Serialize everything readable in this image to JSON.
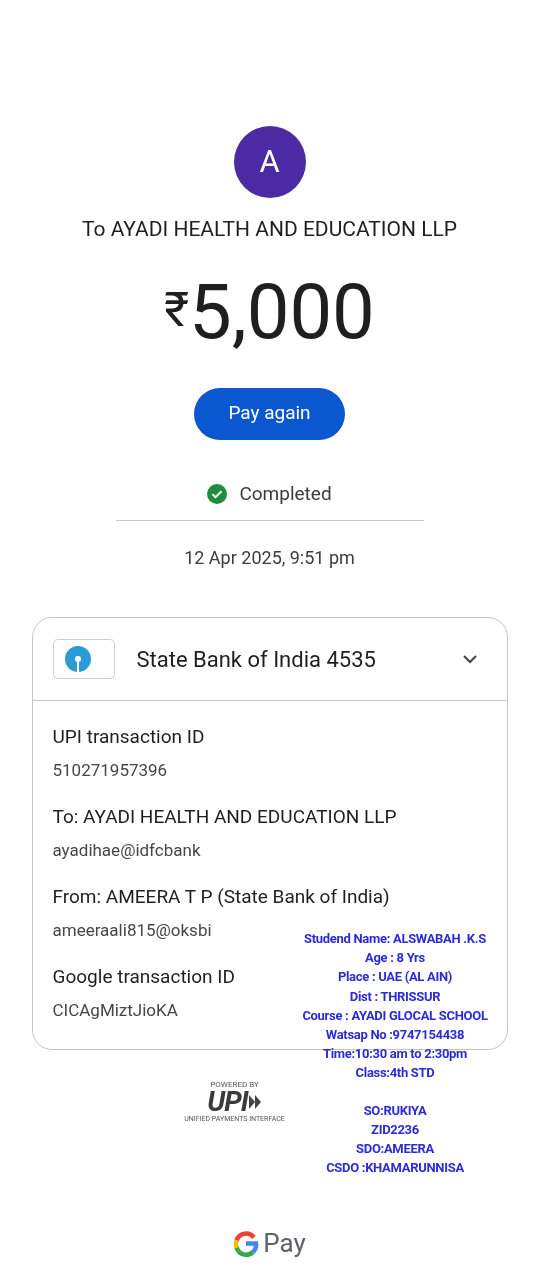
{
  "payee": {
    "avatar_letter": "A",
    "title": "To AYADI HEALTH AND EDUCATION LLP"
  },
  "amount": {
    "currency": "₹",
    "value": "5,000"
  },
  "pay_again_button": "Pay again",
  "status": {
    "label": "Completed",
    "kind": "completed"
  },
  "datetime": "12 Apr 2025, 9:51 pm",
  "details_card": {
    "bank": "State Bank of India 4535",
    "expanded": true,
    "rows": [
      {
        "label": "UPI transaction ID",
        "value": "510271957396"
      },
      {
        "label": "To: AYADI HEALTH AND EDUCATION LLP",
        "value": "ayadihae@idfcbank"
      },
      {
        "label": "From: AMEERA  T P (State Bank of India)",
        "value": "ameeraali815@oksbi"
      },
      {
        "label": "Google transaction ID",
        "value": "CICAgMiztJioKA"
      }
    ]
  },
  "upi_logo": {
    "caption": "POWERED BY",
    "mark": "UPI",
    "subtitle": "UNIFIED PAYMENTS INTERFACE"
  },
  "overlay_note": {
    "lines": [
      "Studend Name: ALSWABAH .K.S",
      "Age : 8 Yrs",
      "Place  : UAE (AL AIN)",
      "Dist : THRISSUR",
      "Course : AYADI GLOCAL SCHOOL",
      "Watsap No :9747154438",
      "Time:10:30 am to 2:30pm",
      "Class:4th STD"
    ],
    "lines_2": [
      "SO:RUKIYA",
      "ZID2236",
      "SDO:AMEERA",
      "CSDO :KHAMARUNNISA"
    ]
  },
  "footer": {
    "brand": "Pay"
  }
}
